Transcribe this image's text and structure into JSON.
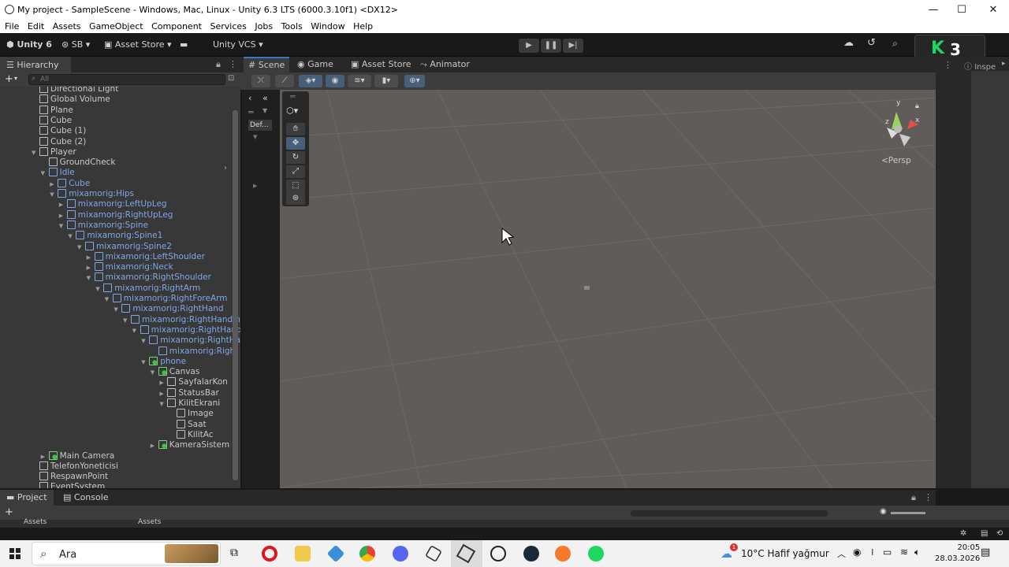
{
  "window": {
    "title": "My project - SampleScene - Windows, Mac, Linux - Unity 6.3 LTS (6000.3.10f1) <DX12>",
    "minimize": "—",
    "maximize": "☐",
    "close": "✕"
  },
  "menu": [
    "File",
    "Edit",
    "Assets",
    "GameObject",
    "Component",
    "Services",
    "Jobs",
    "Tools",
    "Window",
    "Help"
  ],
  "toolbar": {
    "unity_label": "Unity 6",
    "account_label": "SB",
    "asset_store_label": "Asset Store",
    "vcs_label": "Unity VCS",
    "play_icon": "▶",
    "pause_icon": "❚❚",
    "step_icon": "▶|"
  },
  "hierarchy": {
    "tab_label": "Hierarchy",
    "search_placeholder": "All",
    "add_label": "+",
    "rows": [
      {
        "label": "Directional Light",
        "depth": 0,
        "arrow": "",
        "blue": false,
        "green": false
      },
      {
        "label": "Global Volume",
        "depth": 0,
        "arrow": "",
        "blue": false,
        "green": false
      },
      {
        "label": "Plane",
        "depth": 0,
        "arrow": "",
        "blue": false,
        "green": false
      },
      {
        "label": "Cube",
        "depth": 0,
        "arrow": "",
        "blue": false,
        "green": false
      },
      {
        "label": "Cube (1)",
        "depth": 0,
        "arrow": "",
        "blue": false,
        "green": false
      },
      {
        "label": "Cube (2)",
        "depth": 0,
        "arrow": "",
        "blue": false,
        "green": false
      },
      {
        "label": "Player",
        "depth": 0,
        "arrow": "down",
        "blue": false,
        "green": false
      },
      {
        "label": "GroundCheck",
        "depth": 1,
        "arrow": "",
        "blue": false,
        "green": false
      },
      {
        "label": "Idle",
        "depth": 1,
        "arrow": "down",
        "blue": true,
        "green": false
      },
      {
        "label": "Cube",
        "depth": 2,
        "arrow": "right",
        "blue": true,
        "green": false
      },
      {
        "label": "mixamorig:Hips",
        "depth": 2,
        "arrow": "down",
        "blue": true,
        "green": false
      },
      {
        "label": "mixamorig:LeftUpLeg",
        "depth": 3,
        "arrow": "right",
        "blue": true,
        "green": false
      },
      {
        "label": "mixamorig:RightUpLeg",
        "depth": 3,
        "arrow": "right",
        "blue": true,
        "green": false
      },
      {
        "label": "mixamorig:Spine",
        "depth": 3,
        "arrow": "down",
        "blue": true,
        "green": false
      },
      {
        "label": "mixamorig:Spine1",
        "depth": 4,
        "arrow": "down",
        "blue": true,
        "green": false
      },
      {
        "label": "mixamorig:Spine2",
        "depth": 5,
        "arrow": "down",
        "blue": true,
        "green": false
      },
      {
        "label": "mixamorig:LeftShoulder",
        "depth": 6,
        "arrow": "right",
        "blue": true,
        "green": false
      },
      {
        "label": "mixamorig:Neck",
        "depth": 6,
        "arrow": "right",
        "blue": true,
        "green": false
      },
      {
        "label": "mixamorig:RightShoulder",
        "depth": 6,
        "arrow": "down",
        "blue": true,
        "green": false
      },
      {
        "label": "mixamorig:RightArm",
        "depth": 7,
        "arrow": "down",
        "blue": true,
        "green": false
      },
      {
        "label": "mixamorig:RightForeArm",
        "depth": 8,
        "arrow": "down",
        "blue": true,
        "green": false
      },
      {
        "label": "mixamorig:RightHand",
        "depth": 9,
        "arrow": "down",
        "blue": true,
        "green": false
      },
      {
        "label": "mixamorig:RightHandInd",
        "depth": 10,
        "arrow": "down",
        "blue": true,
        "green": false
      },
      {
        "label": "mixamorig:RightHand",
        "depth": 11,
        "arrow": "down",
        "blue": true,
        "green": false
      },
      {
        "label": "mixamorig:RightHa",
        "depth": 12,
        "arrow": "down",
        "blue": true,
        "green": false
      },
      {
        "label": "mixamorig:Right",
        "depth": 13,
        "arrow": "",
        "blue": true,
        "green": false
      },
      {
        "label": "phone",
        "depth": 12,
        "arrow": "down",
        "blue": true,
        "green": true
      },
      {
        "label": "Canvas",
        "depth": 13,
        "arrow": "down",
        "blue": false,
        "green": true
      },
      {
        "label": "SayfalarKon",
        "depth": 14,
        "arrow": "right",
        "blue": false,
        "green": false
      },
      {
        "label": "StatusBar",
        "depth": 14,
        "arrow": "right",
        "blue": false,
        "green": false
      },
      {
        "label": "KilitEkrani",
        "depth": 14,
        "arrow": "down",
        "blue": false,
        "green": false
      },
      {
        "label": "Image",
        "depth": 15,
        "arrow": "",
        "blue": false,
        "green": false
      },
      {
        "label": "Saat",
        "depth": 15,
        "arrow": "",
        "blue": false,
        "green": false
      },
      {
        "label": "KilitAc",
        "depth": 15,
        "arrow": "",
        "blue": false,
        "green": false
      },
      {
        "label": "KameraSistem",
        "depth": 13,
        "arrow": "right",
        "blue": false,
        "green": true
      },
      {
        "label": "Main Camera",
        "depth": 1,
        "arrow": "right",
        "blue": false,
        "green": true
      },
      {
        "label": "TelefonYoneticisi",
        "depth": 0,
        "arrow": "",
        "blue": false,
        "green": false
      },
      {
        "label": "RespawnPoint",
        "depth": 0,
        "arrow": "",
        "blue": false,
        "green": false
      },
      {
        "label": "EventSystem",
        "depth": 0,
        "arrow": "",
        "blue": false,
        "green": false
      }
    ]
  },
  "scene_tabs": [
    {
      "label": "Scene",
      "icon": "#",
      "active": true
    },
    {
      "label": "Game",
      "icon": "◉",
      "active": false
    },
    {
      "label": "Asset Store",
      "icon": "▣",
      "active": false
    },
    {
      "label": "Animator",
      "icon": "⤳",
      "active": false
    }
  ],
  "scene": {
    "overlay_default": "Def...",
    "persp_label": "<Persp",
    "gizmo_y": "y",
    "gizmo_x": "x",
    "gizmo_z": "z"
  },
  "inspector": {
    "tab_label": "Inspe",
    "badge_letter": "K",
    "badge_number": "3"
  },
  "bottom": {
    "project_tab": "Project",
    "console_tab": "Console",
    "assets_label": "Assets",
    "assets_label2": "Assets"
  },
  "taskbar": {
    "search_label": "Ara",
    "weather_temp": "10°C",
    "weather_desc": "Hafif yağmur",
    "time": "20:05",
    "date": "28.03.2026",
    "notif_count": "1"
  },
  "colors": {
    "accent_blue": "#3a79bb",
    "tree_blue": "#7ea7e6",
    "green_badge": "#3fc43f",
    "viewport": "#605c5a"
  }
}
